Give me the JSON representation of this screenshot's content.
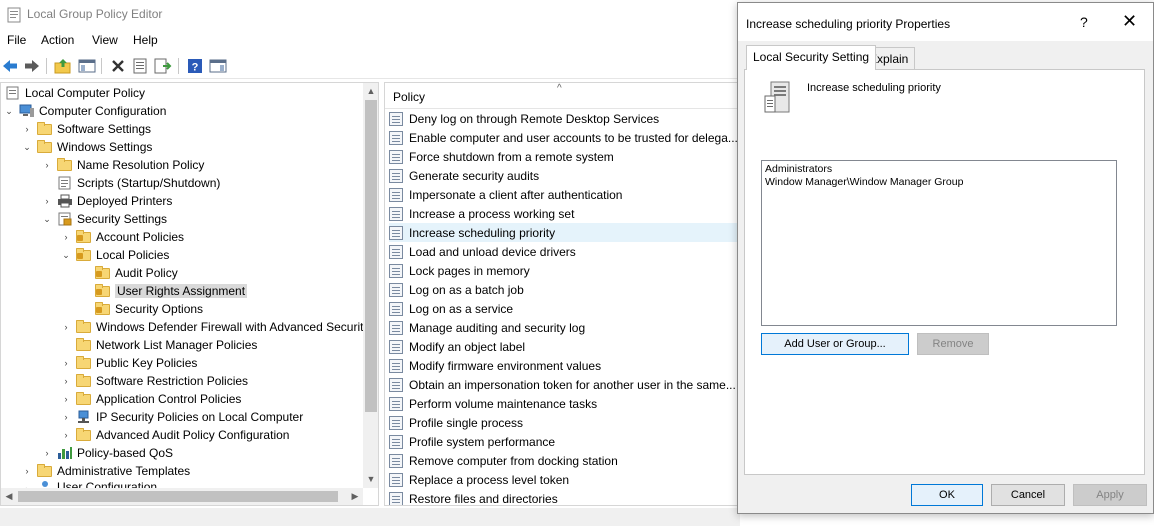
{
  "window": {
    "title": "Local Group Policy Editor"
  },
  "menu": {
    "items": [
      "File",
      "Action",
      "View",
      "Help"
    ]
  },
  "toolbar": {
    "icons": [
      "back-arrow-icon",
      "forward-arrow-icon",
      "up-folder-icon",
      "show-hide-tree-icon",
      "delete-icon",
      "properties-icon",
      "export-list-icon",
      "help-icon",
      "show-hide-action-pane-icon"
    ]
  },
  "tree": {
    "items": [
      {
        "label": "Local Computer Policy",
        "icon": "computer-policy-icon"
      },
      {
        "label": "Computer Configuration",
        "icon": "computer-icon"
      },
      {
        "label": "Software Settings",
        "icon": "folder-icon"
      },
      {
        "label": "Windows Settings",
        "icon": "folder-icon"
      },
      {
        "label": "Name Resolution Policy",
        "icon": "folder-icon"
      },
      {
        "label": "Scripts (Startup/Shutdown)",
        "icon": "script-icon"
      },
      {
        "label": "Deployed Printers",
        "icon": "printer-icon"
      },
      {
        "label": "Security Settings",
        "icon": "security-settings-icon"
      },
      {
        "label": "Account Policies",
        "icon": "folder-lock-icon"
      },
      {
        "label": "Local Policies",
        "icon": "folder-lock-icon"
      },
      {
        "label": "Audit Policy",
        "icon": "folder-lock-icon"
      },
      {
        "label": "User Rights Assignment",
        "icon": "folder-lock-icon"
      },
      {
        "label": "Security Options",
        "icon": "folder-lock-icon"
      },
      {
        "label": "Windows Defender Firewall with Advanced Securit",
        "icon": "folder-icon"
      },
      {
        "label": "Network List Manager Policies",
        "icon": "folder-icon"
      },
      {
        "label": "Public Key Policies",
        "icon": "folder-icon"
      },
      {
        "label": "Software Restriction Policies",
        "icon": "folder-icon"
      },
      {
        "label": "Application Control Policies",
        "icon": "folder-icon"
      },
      {
        "label": "IP Security Policies on Local Computer",
        "icon": "ip-security-icon"
      },
      {
        "label": "Advanced Audit Policy Configuration",
        "icon": "folder-icon"
      },
      {
        "label": "Policy-based QoS",
        "icon": "qos-chart-icon"
      },
      {
        "label": "Administrative Templates",
        "icon": "folder-icon"
      },
      {
        "label": "User Configuration",
        "icon": "user-icon"
      }
    ]
  },
  "policy_list": {
    "header": "Policy",
    "items": [
      "Deny log on through Remote Desktop Services",
      "Enable computer and user accounts to be trusted for delega...",
      "Force shutdown from a remote system",
      "Generate security audits",
      "Impersonate a client after authentication",
      "Increase a process working set",
      "Increase scheduling priority",
      "Load and unload device drivers",
      "Lock pages in memory",
      "Log on as a batch job",
      "Log on as a service",
      "Manage auditing and security log",
      "Modify an object label",
      "Modify firmware environment values",
      "Obtain an impersonation token for another user in the same...",
      "Perform volume maintenance tasks",
      "Profile single process",
      "Profile system performance",
      "Remove computer from docking station",
      "Replace a process level token",
      "Restore files and directories"
    ]
  },
  "dialog": {
    "title": "Increase scheduling priority Properties",
    "help_glyph": "?",
    "close_glyph": "✕",
    "tabs": [
      "Local Security Setting",
      "Explain"
    ],
    "policy_name": "Increase scheduling priority",
    "members": [
      "Administrators",
      "Window Manager\\Window Manager Group"
    ],
    "add_button": "Add User or Group...",
    "remove_button": "Remove",
    "ok_button": "OK",
    "cancel_button": "Cancel",
    "apply_button": "Apply"
  }
}
